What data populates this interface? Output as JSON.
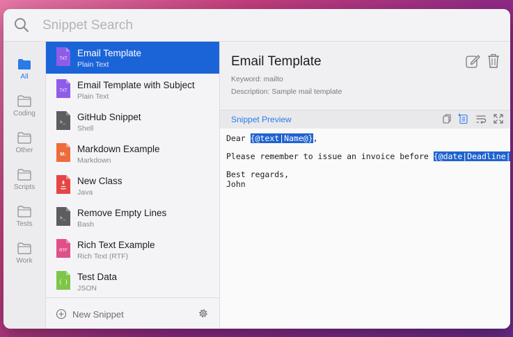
{
  "search": {
    "placeholder": "Snippet Search",
    "value": ""
  },
  "categories": [
    {
      "label": "All",
      "active": true
    },
    {
      "label": "Coding"
    },
    {
      "label": "Other"
    },
    {
      "label": "Scripts"
    },
    {
      "label": "Tests"
    },
    {
      "label": "Work"
    }
  ],
  "snippets": [
    {
      "title": "Email Template",
      "subtitle": "Plain Text",
      "icon": "TXT",
      "color": "#8f5ce8",
      "selected": true
    },
    {
      "title": "Email Template with Subject",
      "subtitle": "Plain Text",
      "icon": "TXT",
      "color": "#8f5ce8"
    },
    {
      "title": "GitHub Snippet",
      "subtitle": "Shell",
      "icon": ">_",
      "color": "#5d5d61"
    },
    {
      "title": "Markdown Example",
      "subtitle": "Markdown",
      "icon": "M↓",
      "color": "#ee6b3b"
    },
    {
      "title": "New Class",
      "subtitle": "Java",
      "icon": "java",
      "color": "#e64545"
    },
    {
      "title": "Remove Empty Lines",
      "subtitle": "Bash",
      "icon": ">_",
      "color": "#5d5d61"
    },
    {
      "title": "Rich Text Example",
      "subtitle": "Rich Text (RTF)",
      "icon": "RTF",
      "color": "#e04f8a"
    },
    {
      "title": "Test Data",
      "subtitle": "JSON",
      "icon": "{ }",
      "color": "#7ec64a"
    }
  ],
  "footer": {
    "new_snippet": "New Snippet"
  },
  "detail": {
    "title": "Email Template",
    "keyword": "Keyword: mailto",
    "description": "Description: Sample mail template",
    "preview_label": "Snippet Preview"
  },
  "code": {
    "line1_prefix": "Dear ",
    "line1_token": "{@text|Name@}",
    "line1_suffix": ",",
    "line2_prefix": "Please remember to issue an invoice before ",
    "line2_token": "{@date|Deadline|dd.",
    "line3": "Best regards,",
    "line4": "John"
  },
  "colors": {
    "accent": "#1b64d8",
    "link": "#2a7ae8",
    "highlight": "#1f62cf"
  }
}
